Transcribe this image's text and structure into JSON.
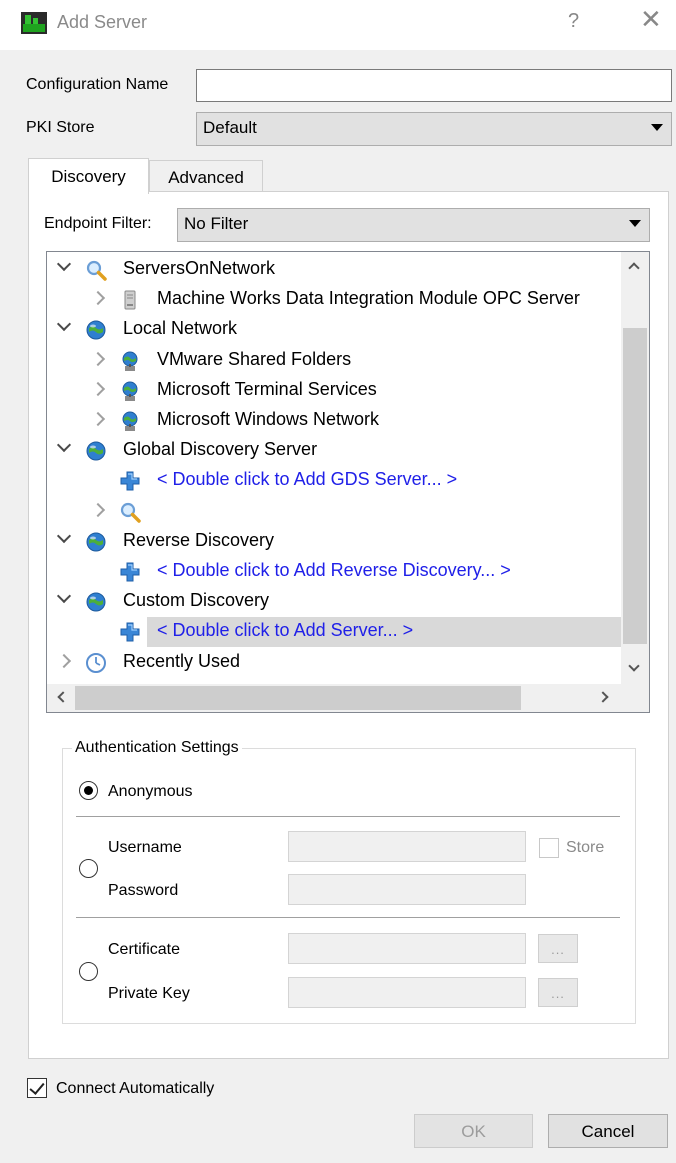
{
  "window": {
    "title": "Add Server",
    "help_glyph": "?",
    "close_glyph": "✕"
  },
  "form": {
    "config_name_label": "Configuration Name",
    "config_name_value": "",
    "pki_store_label": "PKI Store",
    "pki_store_value": "Default"
  },
  "tabs": [
    {
      "label": "Discovery",
      "active": true
    },
    {
      "label": "Advanced",
      "active": false
    }
  ],
  "discovery": {
    "endpoint_filter_label": "Endpoint Filter:",
    "endpoint_filter_value": "No Filter",
    "tree": [
      {
        "label": "ServersOnNetwork",
        "level": 0,
        "expander": "open",
        "icon": "search-icon"
      },
      {
        "label": "Machine Works Data Integration Module OPC Server",
        "level": 1,
        "expander": "closed",
        "icon": "server-icon"
      },
      {
        "label": "Local Network",
        "level": 0,
        "expander": "open",
        "icon": "network-globe-icon"
      },
      {
        "label": "VMware Shared Folders",
        "level": 1,
        "expander": "closed",
        "icon": "network-host-icon"
      },
      {
        "label": "Microsoft Terminal Services",
        "level": 1,
        "expander": "closed",
        "icon": "network-host-icon"
      },
      {
        "label": "Microsoft Windows Network",
        "level": 1,
        "expander": "closed",
        "icon": "network-host-icon"
      },
      {
        "label": "Global Discovery Server",
        "level": 0,
        "expander": "open",
        "icon": "network-globe-icon"
      },
      {
        "label": "< Double click to Add GDS Server... >",
        "level": 1,
        "expander": "none",
        "icon": "add-plus-icon",
        "link": true
      },
      {
        "label": "",
        "level": 1,
        "expander": "closed",
        "icon": "search-icon"
      },
      {
        "label": "Reverse Discovery",
        "level": 0,
        "expander": "open",
        "icon": "network-globe-icon"
      },
      {
        "label": "< Double click to Add Reverse Discovery... >",
        "level": 1,
        "expander": "none",
        "icon": "add-plus-icon",
        "link": true
      },
      {
        "label": "Custom Discovery",
        "level": 0,
        "expander": "open",
        "icon": "network-globe-icon"
      },
      {
        "label": "< Double click to Add Server... >",
        "level": 1,
        "expander": "none",
        "icon": "add-plus-icon",
        "link": true,
        "selected": true
      },
      {
        "label": "Recently Used",
        "level": 0,
        "expander": "closed",
        "icon": "clock-icon"
      }
    ]
  },
  "auth": {
    "group_title": "Authentication Settings",
    "anonymous_label": "Anonymous",
    "anonymous_selected": true,
    "username_label": "Username",
    "password_label": "Password",
    "store_label": "Store",
    "certificate_label": "Certificate",
    "private_key_label": "Private Key",
    "browse_label": "..."
  },
  "connect_automatically_label": "Connect Automatically",
  "connect_automatically_checked": true,
  "buttons": {
    "ok": "OK",
    "cancel": "Cancel"
  },
  "colors": {
    "link": "#2020e8",
    "selected_row": "#d9d9d9"
  }
}
